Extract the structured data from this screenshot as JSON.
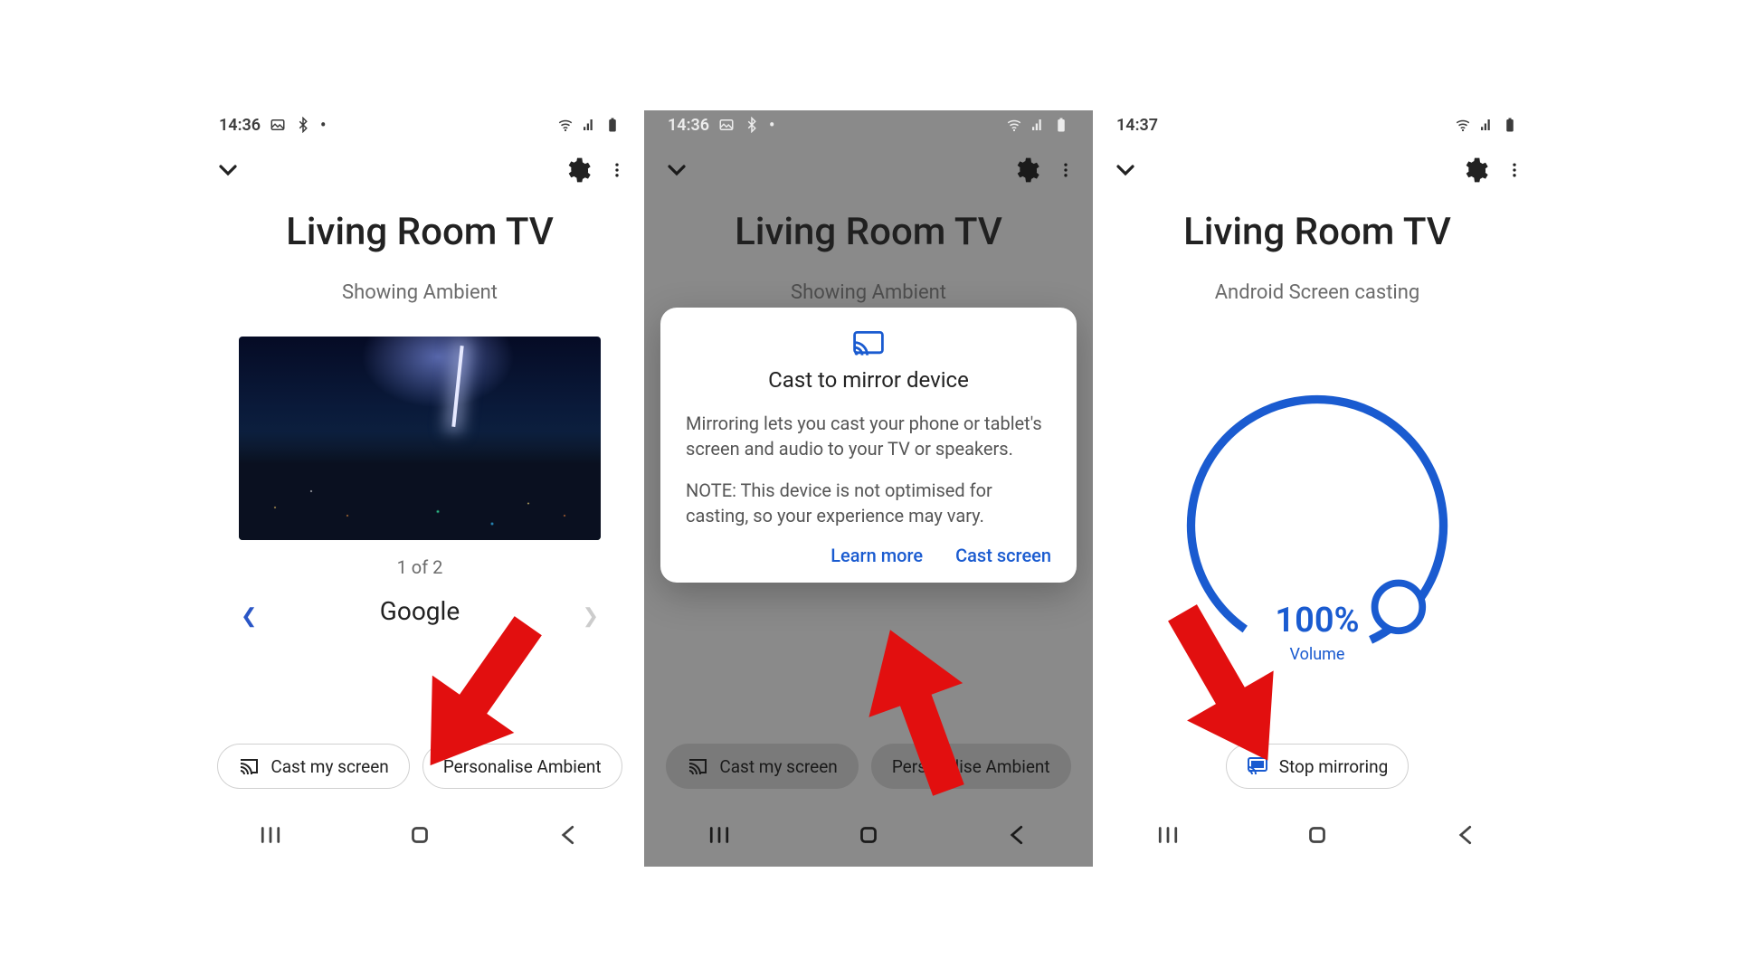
{
  "p1": {
    "sb_time": "14:36",
    "title": "Living Room TV",
    "subtitle": "Showing Ambient",
    "counter": "1 of 2",
    "slide_label": "Google",
    "chip_cast": "Cast my screen",
    "chip_ambient": "Personalise Ambient"
  },
  "p2": {
    "sb_time": "14:36",
    "title": "Living Room TV",
    "subtitle": "Showing Ambient",
    "chip_cast": "Cast my screen",
    "chip_ambient": "Personalise Ambient",
    "dlg_title": "Cast to mirror device",
    "dlg_p1": "Mirroring lets you cast your phone or tablet's screen and audio to your TV or speakers.",
    "dlg_p2": "NOTE: This device is not optimised for casting, so your experience may vary.",
    "dlg_learn": "Learn more",
    "dlg_cast": "Cast screen"
  },
  "p3": {
    "sb_time": "14:37",
    "title": "Living Room TV",
    "subtitle": "Android Screen casting",
    "vol_pct": "100%",
    "vol_lbl": "Volume",
    "chip_stop": "Stop mirroring"
  }
}
